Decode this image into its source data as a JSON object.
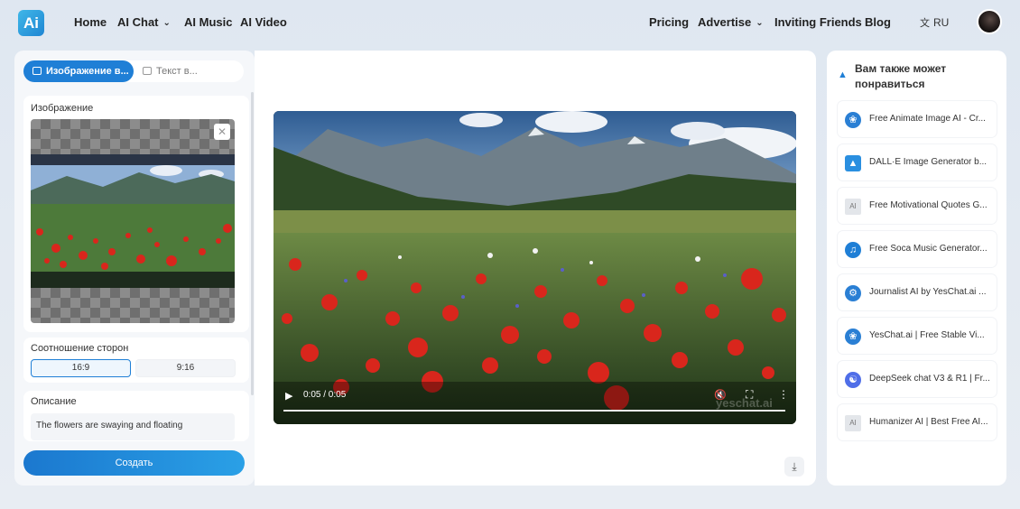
{
  "header": {
    "logo_text": "Ai",
    "nav_left": [
      "Home",
      "AI Chat",
      "AI Music",
      "AI Video"
    ],
    "nav_right": [
      "Pricing",
      "Advertise",
      "Inviting Friends",
      "Blog"
    ],
    "language": "RU"
  },
  "left_panel": {
    "tabs": [
      "Изображение в...",
      "Текст в..."
    ],
    "image_label": "Изображение",
    "ratio_label": "Соотношение сторон",
    "ratios": [
      "16:9",
      "9:16"
    ],
    "description_label": "Описание",
    "description_value": "The flowers are swaying and floating",
    "create_button": "Создать"
  },
  "player": {
    "time": "0:05 / 0:05",
    "watermark": "yeschat.ai",
    "progress": 1.0
  },
  "recommendations": {
    "title": "Вам также может понравиться",
    "items": [
      {
        "label": "Free Animate Image AI - Cr...",
        "icon": "film-reel-icon"
      },
      {
        "label": "DALL·E Image Generator b...",
        "icon": "mountain-image-icon"
      },
      {
        "label": "Free Motivational Quotes G...",
        "icon": "broken-image-icon"
      },
      {
        "label": "Free Soca Music Generator...",
        "icon": "music-globe-icon"
      },
      {
        "label": "Journalist AI by YesChat.ai ...",
        "icon": "gear-atom-icon"
      },
      {
        "label": "YesChat.ai | Free Stable Vi...",
        "icon": "film-reel-icon"
      },
      {
        "label": "DeepSeek chat V3 & R1 | Fr...",
        "icon": "whale-icon"
      },
      {
        "label": "Humanizer AI | Best Free AI...",
        "icon": "broken-image-icon"
      }
    ]
  },
  "colors": {
    "accent": "#1f7fd6"
  }
}
